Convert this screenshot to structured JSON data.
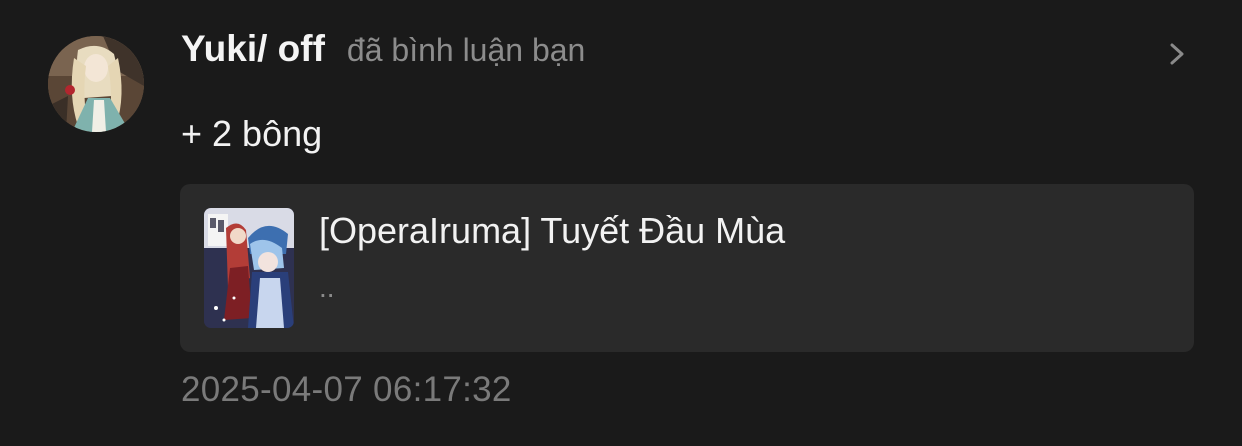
{
  "notification": {
    "username": "Yuki/ off",
    "action": "đã bình luận bạn",
    "comment": "+ 2 bông",
    "timestamp": "2025-04-07 06:17:32"
  },
  "story_card": {
    "title": "[OperaIruma] Tuyết Đầu Mùa",
    "excerpt": ".."
  },
  "icons": {
    "chevron": "chevron-right-icon"
  },
  "colors": {
    "background": "#1a1a1a",
    "card_background": "#2a2a2a",
    "primary_text": "#f2f2f2",
    "secondary_text": "#8c8c8c"
  }
}
